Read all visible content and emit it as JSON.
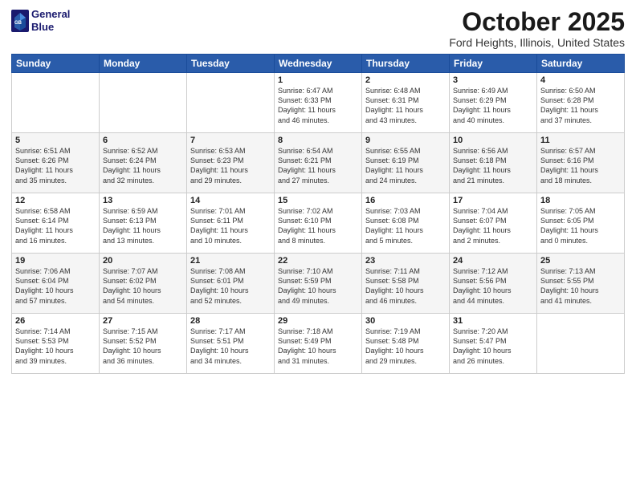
{
  "header": {
    "logo_line1": "General",
    "logo_line2": "Blue",
    "month": "October 2025",
    "location": "Ford Heights, Illinois, United States"
  },
  "weekdays": [
    "Sunday",
    "Monday",
    "Tuesday",
    "Wednesday",
    "Thursday",
    "Friday",
    "Saturday"
  ],
  "weeks": [
    [
      {
        "day": "",
        "info": ""
      },
      {
        "day": "",
        "info": ""
      },
      {
        "day": "",
        "info": ""
      },
      {
        "day": "1",
        "info": "Sunrise: 6:47 AM\nSunset: 6:33 PM\nDaylight: 11 hours\nand 46 minutes."
      },
      {
        "day": "2",
        "info": "Sunrise: 6:48 AM\nSunset: 6:31 PM\nDaylight: 11 hours\nand 43 minutes."
      },
      {
        "day": "3",
        "info": "Sunrise: 6:49 AM\nSunset: 6:29 PM\nDaylight: 11 hours\nand 40 minutes."
      },
      {
        "day": "4",
        "info": "Sunrise: 6:50 AM\nSunset: 6:28 PM\nDaylight: 11 hours\nand 37 minutes."
      }
    ],
    [
      {
        "day": "5",
        "info": "Sunrise: 6:51 AM\nSunset: 6:26 PM\nDaylight: 11 hours\nand 35 minutes."
      },
      {
        "day": "6",
        "info": "Sunrise: 6:52 AM\nSunset: 6:24 PM\nDaylight: 11 hours\nand 32 minutes."
      },
      {
        "day": "7",
        "info": "Sunrise: 6:53 AM\nSunset: 6:23 PM\nDaylight: 11 hours\nand 29 minutes."
      },
      {
        "day": "8",
        "info": "Sunrise: 6:54 AM\nSunset: 6:21 PM\nDaylight: 11 hours\nand 27 minutes."
      },
      {
        "day": "9",
        "info": "Sunrise: 6:55 AM\nSunset: 6:19 PM\nDaylight: 11 hours\nand 24 minutes."
      },
      {
        "day": "10",
        "info": "Sunrise: 6:56 AM\nSunset: 6:18 PM\nDaylight: 11 hours\nand 21 minutes."
      },
      {
        "day": "11",
        "info": "Sunrise: 6:57 AM\nSunset: 6:16 PM\nDaylight: 11 hours\nand 18 minutes."
      }
    ],
    [
      {
        "day": "12",
        "info": "Sunrise: 6:58 AM\nSunset: 6:14 PM\nDaylight: 11 hours\nand 16 minutes."
      },
      {
        "day": "13",
        "info": "Sunrise: 6:59 AM\nSunset: 6:13 PM\nDaylight: 11 hours\nand 13 minutes."
      },
      {
        "day": "14",
        "info": "Sunrise: 7:01 AM\nSunset: 6:11 PM\nDaylight: 11 hours\nand 10 minutes."
      },
      {
        "day": "15",
        "info": "Sunrise: 7:02 AM\nSunset: 6:10 PM\nDaylight: 11 hours\nand 8 minutes."
      },
      {
        "day": "16",
        "info": "Sunrise: 7:03 AM\nSunset: 6:08 PM\nDaylight: 11 hours\nand 5 minutes."
      },
      {
        "day": "17",
        "info": "Sunrise: 7:04 AM\nSunset: 6:07 PM\nDaylight: 11 hours\nand 2 minutes."
      },
      {
        "day": "18",
        "info": "Sunrise: 7:05 AM\nSunset: 6:05 PM\nDaylight: 11 hours\nand 0 minutes."
      }
    ],
    [
      {
        "day": "19",
        "info": "Sunrise: 7:06 AM\nSunset: 6:04 PM\nDaylight: 10 hours\nand 57 minutes."
      },
      {
        "day": "20",
        "info": "Sunrise: 7:07 AM\nSunset: 6:02 PM\nDaylight: 10 hours\nand 54 minutes."
      },
      {
        "day": "21",
        "info": "Sunrise: 7:08 AM\nSunset: 6:01 PM\nDaylight: 10 hours\nand 52 minutes."
      },
      {
        "day": "22",
        "info": "Sunrise: 7:10 AM\nSunset: 5:59 PM\nDaylight: 10 hours\nand 49 minutes."
      },
      {
        "day": "23",
        "info": "Sunrise: 7:11 AM\nSunset: 5:58 PM\nDaylight: 10 hours\nand 46 minutes."
      },
      {
        "day": "24",
        "info": "Sunrise: 7:12 AM\nSunset: 5:56 PM\nDaylight: 10 hours\nand 44 minutes."
      },
      {
        "day": "25",
        "info": "Sunrise: 7:13 AM\nSunset: 5:55 PM\nDaylight: 10 hours\nand 41 minutes."
      }
    ],
    [
      {
        "day": "26",
        "info": "Sunrise: 7:14 AM\nSunset: 5:53 PM\nDaylight: 10 hours\nand 39 minutes."
      },
      {
        "day": "27",
        "info": "Sunrise: 7:15 AM\nSunset: 5:52 PM\nDaylight: 10 hours\nand 36 minutes."
      },
      {
        "day": "28",
        "info": "Sunrise: 7:17 AM\nSunset: 5:51 PM\nDaylight: 10 hours\nand 34 minutes."
      },
      {
        "day": "29",
        "info": "Sunrise: 7:18 AM\nSunset: 5:49 PM\nDaylight: 10 hours\nand 31 minutes."
      },
      {
        "day": "30",
        "info": "Sunrise: 7:19 AM\nSunset: 5:48 PM\nDaylight: 10 hours\nand 29 minutes."
      },
      {
        "day": "31",
        "info": "Sunrise: 7:20 AM\nSunset: 5:47 PM\nDaylight: 10 hours\nand 26 minutes."
      },
      {
        "day": "",
        "info": ""
      }
    ]
  ]
}
